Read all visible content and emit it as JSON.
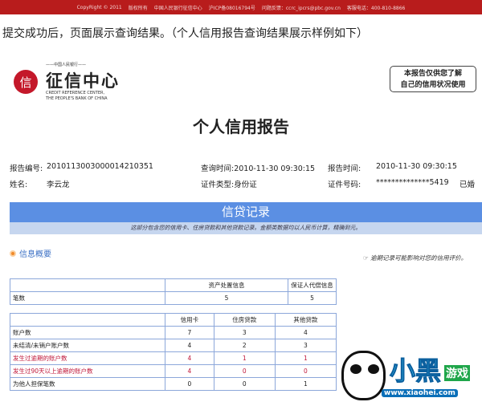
{
  "footer": {
    "copyright": "CopyRight © 2011",
    "rights": "版权所有",
    "org": "中国人民银行征信中心",
    "icp": "沪ICP备08016794号",
    "feedback": "问题反馈：ccrc_ipcrs@pbc.gov.cn",
    "hotline": "客服电话：400-810-8866"
  },
  "intro": "提交成功后，页面展示查询结果。（个人信用报告查询结果展示样例如下）",
  "logo": {
    "bank": "——中国人民银行——",
    "name": "征信中心",
    "en1": "CREDIT REFERENCE CENTER,",
    "en2": "THE PEOPLE'S BANK OF CHINA"
  },
  "stamp": {
    "line1": "本报告仅供您了解",
    "line2": "自己的信用状况使用"
  },
  "title": "个人信用报告",
  "info": {
    "report_no_label": "报告编号:",
    "report_no": "2010113003000014210351",
    "query_time": "查询时间:2010-11-30 09:30:15",
    "report_time_label": "报告时间:",
    "report_time": "2010-11-30 09:30:15",
    "name_label": "姓名:",
    "name": "李云龙",
    "id_type": "证件类型:身份证",
    "id_no_label": "证件号码:",
    "id_no": "**************5419",
    "marital": "已婚"
  },
  "credit": {
    "heading": "信贷记录",
    "subtitle": "这部分包含您的信用卡、住房贷款和其他贷款记录。金额类数据均以人民币计算，精确到元。"
  },
  "summary": {
    "heading": "信息概要",
    "note": "逾期记录可能影响对您的信用评价。"
  },
  "table1": {
    "headers": [
      "",
      "资产处置信息",
      "保证人代偿信息"
    ],
    "rows": [
      [
        "笔数",
        "5",
        "5"
      ]
    ]
  },
  "table2": {
    "headers": [
      "",
      "信用卡",
      "住房贷款",
      "其他贷款"
    ],
    "rows": [
      [
        "账户数",
        "7",
        "3",
        "4"
      ],
      [
        "未结清/未销户账户数",
        "4",
        "2",
        "3"
      ],
      [
        "发生过逾期的账户数",
        "4",
        "1",
        "1"
      ],
      [
        "发生过90天以上逾期的账户数",
        "4",
        "0",
        "0"
      ],
      [
        "为他人担保笔数",
        "0",
        "0",
        "1"
      ]
    ]
  },
  "watermark": {
    "brand": "小黑",
    "sub": "游戏",
    "url": "www.xiaohei.com"
  }
}
